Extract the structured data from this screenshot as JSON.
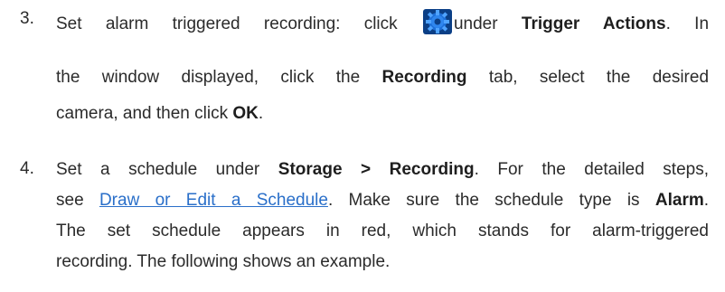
{
  "steps": [
    {
      "number": "3.",
      "line1_a": "Set alarm triggered recording: click",
      "line1_b": "under",
      "line1_bold": "Trigger Actions",
      "line1_end": ". In",
      "line2_a": "the window displayed, click the",
      "line2_bold": "Recording",
      "line2_b": "tab, select the desired",
      "line3_a": "camera, and then click",
      "line3_bold": "OK",
      "line3_end": ".",
      "icon": "gear-icon"
    },
    {
      "number": "4.",
      "line1_a": "Set a schedule under",
      "line1_bold": "Storage > Recording",
      "line1_end": ". For the detailed steps,",
      "line2_a": "see",
      "line2_link": "Draw or Edit a Schedule",
      "line2_b": ". Make sure the schedule type is",
      "line2_bold": "Alarm",
      "line2_end": ".",
      "line3": "The set schedule appears in red, which stands for alarm-triggered",
      "line4": "recording. The following shows an example."
    }
  ],
  "colors": {
    "text": "#2b2b2b",
    "link": "#2a6fc9",
    "icon_blue": "#1d6fd8"
  }
}
